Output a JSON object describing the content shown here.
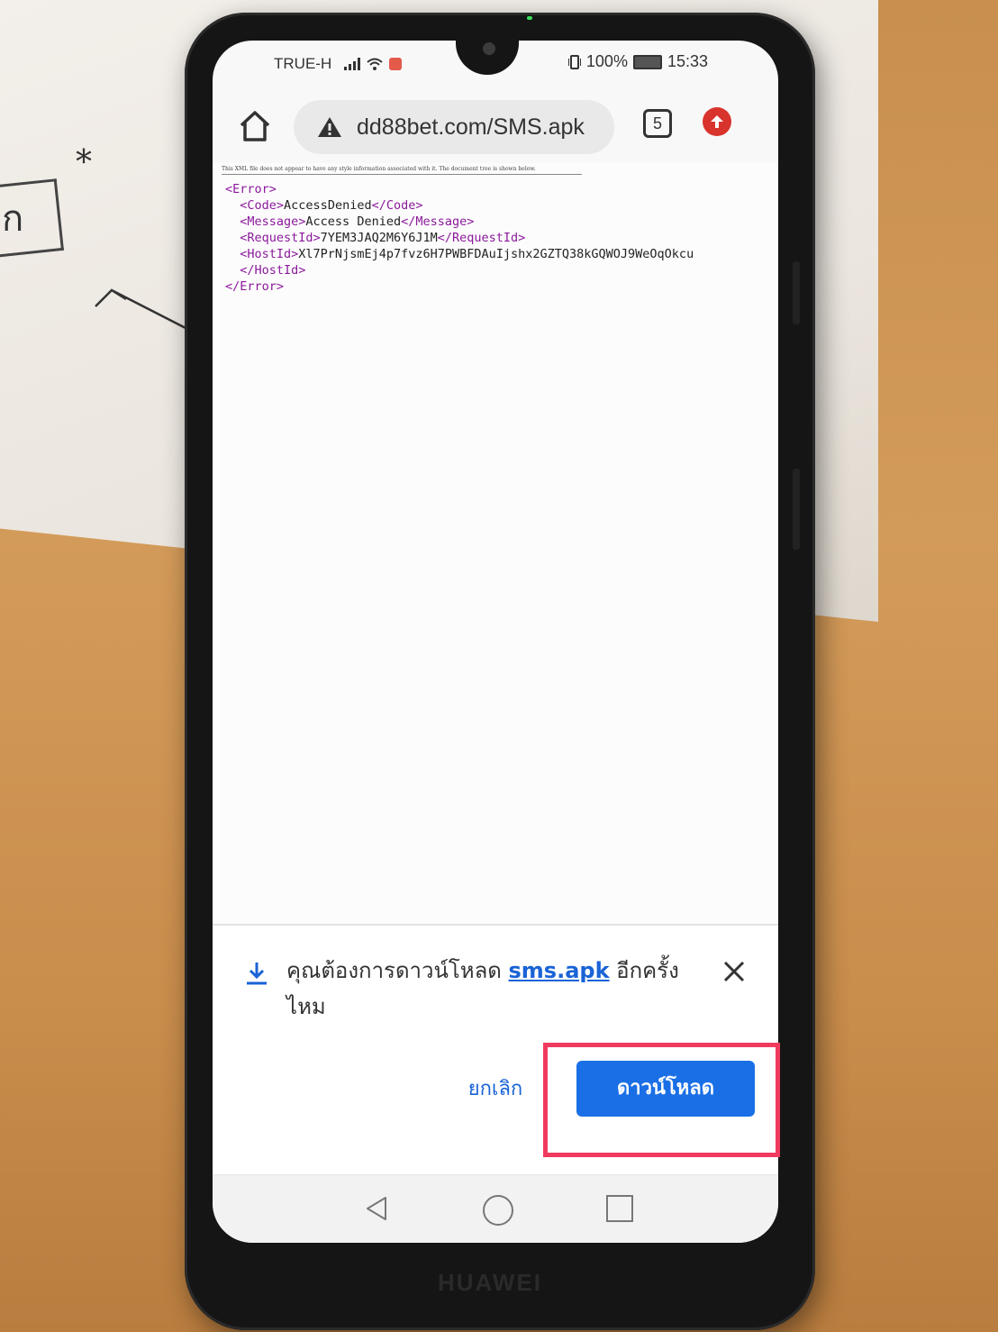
{
  "status_bar": {
    "carrier": "TRUE-H",
    "battery": "100%",
    "time": "15:33"
  },
  "toolbar": {
    "url": "dd88bet.com/SMS.apk",
    "tab_count": "5",
    "icons": [
      "home-icon",
      "warning-icon",
      "tabs-icon",
      "update-icon"
    ]
  },
  "page": {
    "xml_notice": "This XML file does not appear to have any style information associated with it. The document tree is shown below.",
    "error_open": "<Error>",
    "code_open": "<Code>",
    "code_value": "AccessDenied",
    "code_close": "</Code>",
    "message_open": "<Message>",
    "message_value": "Access Denied",
    "message_close": "</Message>",
    "requestid_open": "<RequestId>",
    "requestid_value": "7YEM3JAQ2M6Y6J1M",
    "requestid_close": "</RequestId>",
    "hostid_open": "<HostId>",
    "hostid_value": "Xl7PrNjsmEj4p7fvz6H7PWBFDAuIjshx2GZTQ38kGQWOJ9WeOqOkcu",
    "hostid_close": "</HostId>",
    "error_close": "</Error>"
  },
  "download_prompt": {
    "text_before": "คุณต้องการดาวน์โหลด ",
    "file_link": "sms.apk",
    "text_after": " อีกครั้งไหม",
    "cancel_label": "ยกเลิก",
    "download_label": "ดาวน์โหลด"
  },
  "device": {
    "brand": "HUAWEI"
  },
  "sketch": {
    "letter": "ก",
    "star": "*"
  },
  "colors": {
    "accent": "#1a6fe6",
    "link": "#1a63d6",
    "highlight": "#f03a5f",
    "xml_tag": "#8a1a9a"
  }
}
